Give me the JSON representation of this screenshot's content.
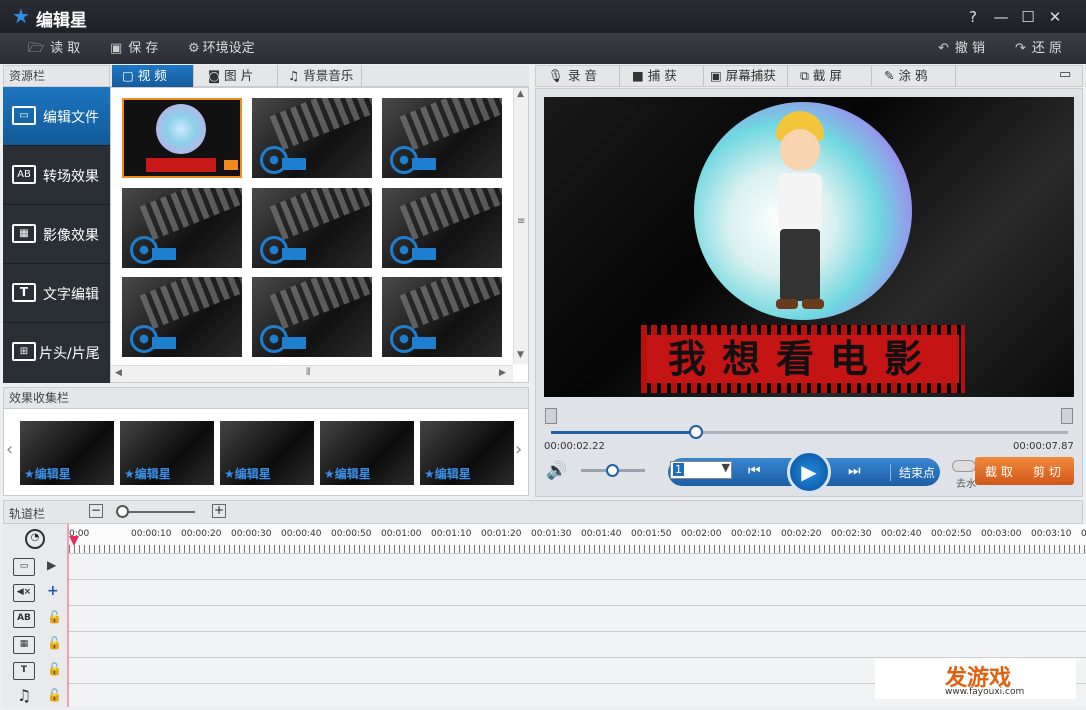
{
  "app": {
    "title": "编辑星",
    "help": "?",
    "min": "—",
    "max": "☐",
    "close": "✕"
  },
  "menu": {
    "open": "读 取",
    "save": "保 存",
    "settings": "环境设定",
    "undo": "撤 销",
    "redo": "还 原"
  },
  "resource_panel": {
    "header": "资源栏"
  },
  "sidebar": {
    "items": [
      {
        "label": "编辑文件",
        "icon": "film-icon"
      },
      {
        "label": "转场效果",
        "icon": "ab-icon"
      },
      {
        "label": "影像效果",
        "icon": "image-effect-icon"
      },
      {
        "label": "文字编辑",
        "icon": "text-icon"
      },
      {
        "label": "片头/片尾",
        "icon": "title-icon"
      }
    ]
  },
  "media_tabs": [
    {
      "label": "视 频"
    },
    {
      "label": "图 片"
    },
    {
      "label": "背景音乐"
    }
  ],
  "effects_panel": {
    "header": "效果收集栏",
    "thumb_label": "编辑星"
  },
  "tool_tabs": [
    {
      "label": "录 音"
    },
    {
      "label": "捕 获"
    },
    {
      "label": "屏幕捕获"
    },
    {
      "label": "截 屏"
    },
    {
      "label": "涂 鸦"
    }
  ],
  "preview": {
    "banner_text": "我想看电影",
    "time_current": "00:00:02.22",
    "time_total": "00:00:07.87",
    "frame_value": "1",
    "end_point": "结束点",
    "crop": "截 取",
    "cut": "剪 切",
    "remove_label": "去水",
    "progress": 0.29
  },
  "timeline": {
    "header": "轨道栏",
    "ticks": [
      "0:00",
      "00:00:10",
      "00:00:20",
      "00:00:30",
      "00:00:40",
      "00:00:50",
      "00:01:00",
      "00:01:10",
      "00:01:20",
      "00:01:30",
      "00:01:40",
      "00:01:50",
      "00:02:00",
      "00:02:10",
      "00:02:20",
      "00:02:30",
      "00:02:40",
      "00:02:50",
      "00:03:00",
      "00:03:10",
      "00:03:2"
    ]
  },
  "watermark": {
    "brand": "发游戏",
    "url": "www.fayouxi.com"
  },
  "colors": {
    "accent": "#1e78c4",
    "selection": "#f08a1a",
    "cut_button": "#e06a1a"
  }
}
